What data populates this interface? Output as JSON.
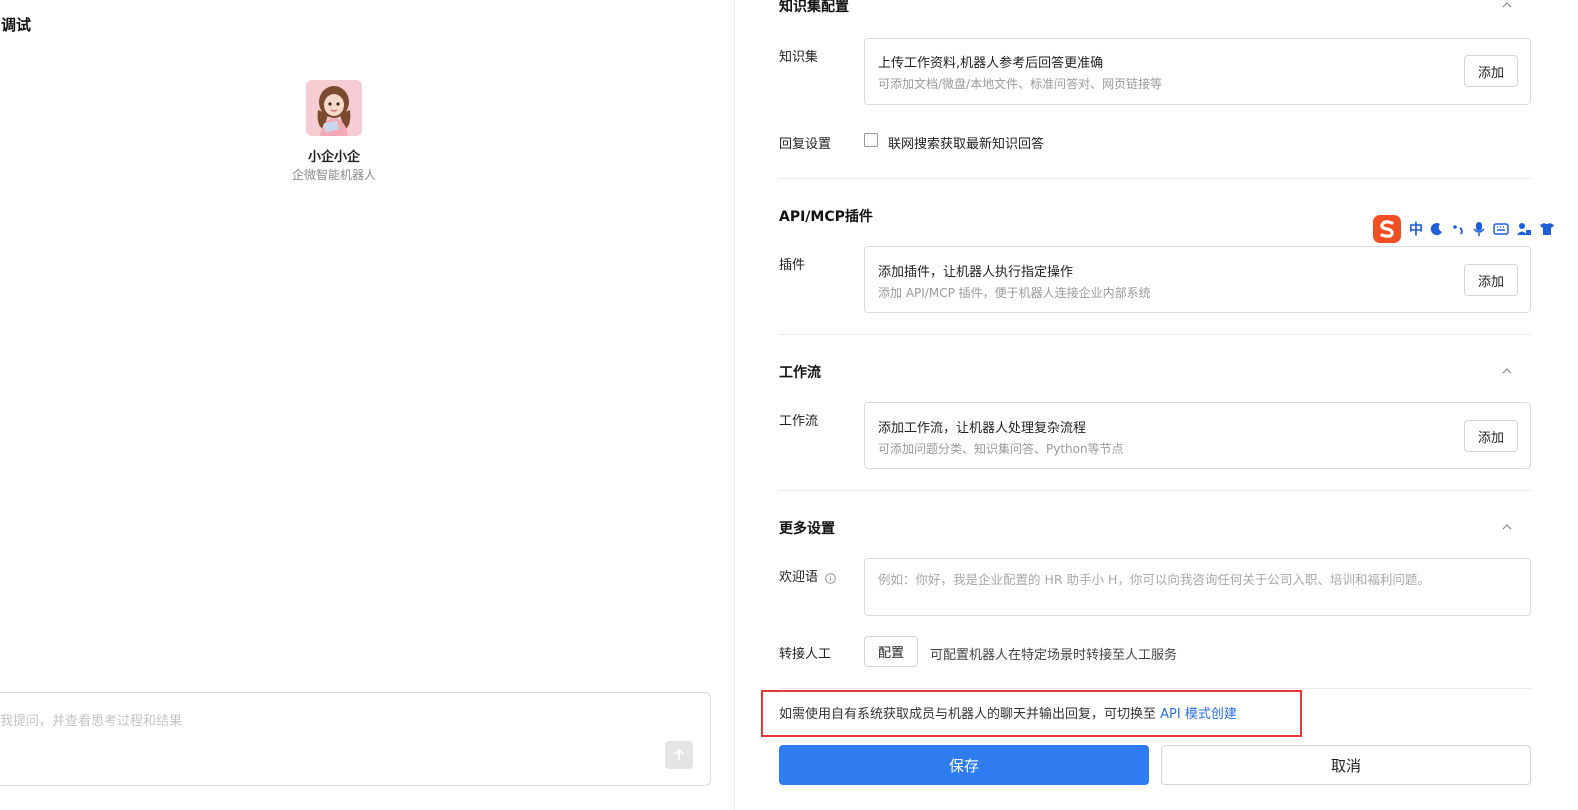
{
  "left": {
    "title": "与调试",
    "bot_name": "小企小企",
    "bot_subtitle": "企微智能机器人",
    "chat_placeholder": "我提问，并查看思考过程和结果"
  },
  "sections": {
    "knowledge": {
      "title": "知识集配置",
      "label": "知识集",
      "card_title": "上传工作资料,机器人参考后回答更准确",
      "card_sub": "可添加文档/微盘/本地文件、标准问答对、网页链接等",
      "button": "添加",
      "reply_label": "回复设置",
      "checkbox_label": "联网搜索获取最新知识回答"
    },
    "plugins": {
      "title": "API/MCP插件",
      "label": "插件",
      "card_title": "添加插件，让机器人执行指定操作",
      "card_sub": "添加 API/MCP 插件，便于机器人连接企业内部系统",
      "button": "添加"
    },
    "workflow": {
      "title": "工作流",
      "label": "工作流",
      "card_title": "添加工作流，让机器人处理复杂流程",
      "card_sub": "可添加问题分类、知识集问答、Python等节点",
      "button": "添加"
    },
    "more": {
      "title": "更多设置",
      "welcome_label": "欢迎语",
      "welcome_placeholder": "例如：你好，我是企业配置的 HR 助手小 H，你可以向我咨询任何关于公司入职、培训和福利问题。",
      "transfer_label": "转接人工",
      "transfer_button": "配置",
      "transfer_desc": "可配置机器人在特定场景时转接至人工服务"
    }
  },
  "ime": {
    "mode": "中"
  },
  "note": {
    "text": "如需使用自有系统获取成员与机器人的聊天并输出回复，可切换至 ",
    "link": "API 模式创建"
  },
  "footer": {
    "save": "保存",
    "cancel": "取消"
  },
  "colors": {
    "primary": "#2f7bf0",
    "link": "#2b6ee6",
    "highlight_border": "#e53935",
    "ime_logo": "#f04e23"
  },
  "icons": [
    "chevron-up-icon",
    "info-icon",
    "arrow-up-icon",
    "sogou-logo-icon",
    "moon-icon",
    "punctuation-icon",
    "microphone-icon",
    "keyboard-icon",
    "user-settings-icon",
    "shirt-icon"
  ]
}
